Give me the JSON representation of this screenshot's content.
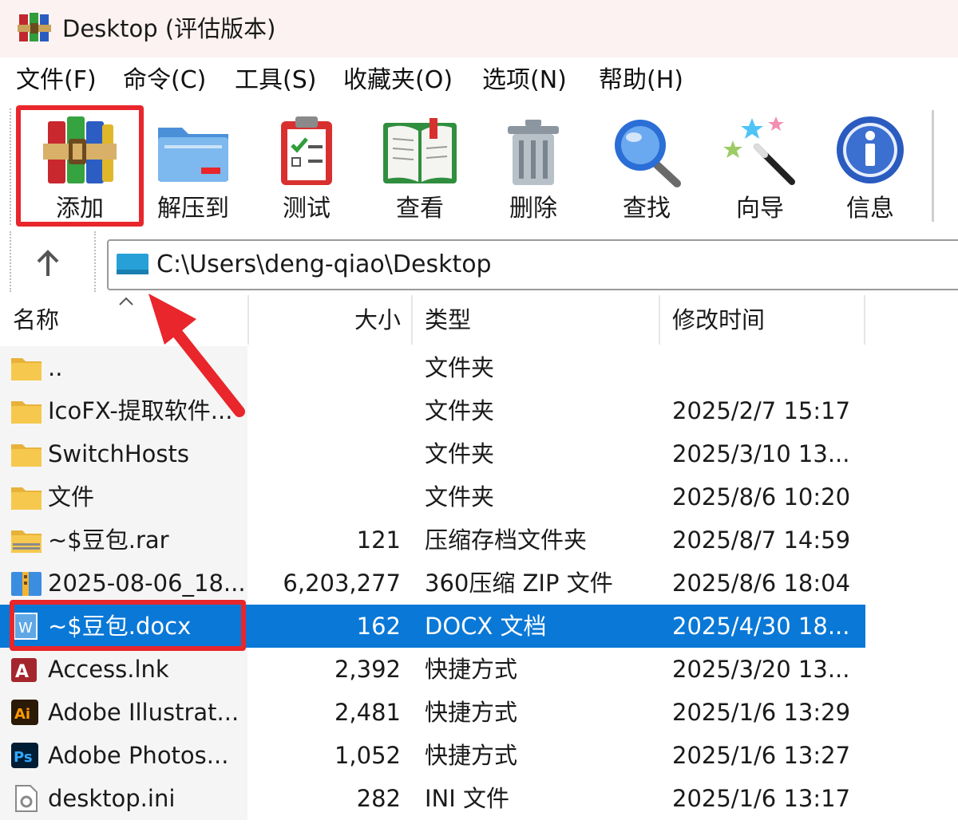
{
  "window": {
    "title": "Desktop (评估版本)"
  },
  "menu": [
    {
      "label": "文件(F)"
    },
    {
      "label": "命令(C)"
    },
    {
      "label": "工具(S)"
    },
    {
      "label": "收藏夹(O)"
    },
    {
      "label": "选项(N)"
    },
    {
      "label": "帮助(H)"
    }
  ],
  "toolbar": [
    {
      "label": "添加",
      "icon": "winrar-books-icon"
    },
    {
      "label": "解压到",
      "icon": "extract-folder-icon"
    },
    {
      "label": "测试",
      "icon": "clipboard-check-icon"
    },
    {
      "label": "查看",
      "icon": "open-book-icon"
    },
    {
      "label": "删除",
      "icon": "trash-icon"
    },
    {
      "label": "查找",
      "icon": "magnifier-icon"
    },
    {
      "label": "向导",
      "icon": "magic-wand-icon"
    },
    {
      "label": "信息",
      "icon": "info-icon"
    }
  ],
  "address": {
    "path": "C:\\Users\\deng-qiao\\Desktop"
  },
  "columns": {
    "name": "名称",
    "size": "大小",
    "type": "类型",
    "modified": "修改时间"
  },
  "files": [
    {
      "name": "..",
      "size": "",
      "type": "文件夹",
      "modified": "",
      "icon": "folder-icon"
    },
    {
      "name": "IcoFX-提取软件...",
      "size": "",
      "type": "文件夹",
      "modified": "2025/2/7 15:17",
      "icon": "folder-icon"
    },
    {
      "name": "SwitchHosts",
      "size": "",
      "type": "文件夹",
      "modified": "2025/3/10 13...",
      "icon": "folder-icon"
    },
    {
      "name": "文件",
      "size": "",
      "type": "文件夹",
      "modified": "2025/8/6 10:20",
      "icon": "folder-icon"
    },
    {
      "name": "~$豆包.rar",
      "size": "121",
      "type": "压缩存档文件夹",
      "modified": "2025/8/7 14:59",
      "icon": "zip-folder-icon"
    },
    {
      "name": "2025-08-06_18...",
      "size": "6,203,277",
      "type": "360压缩 ZIP 文件",
      "modified": "2025/8/6 18:04",
      "icon": "zip-archive-icon"
    },
    {
      "name": "~$豆包.docx",
      "size": "162",
      "type": "DOCX 文档",
      "modified": "2025/4/30 18...",
      "icon": "word-doc-icon",
      "selected": true
    },
    {
      "name": "Access.lnk",
      "size": "2,392",
      "type": "快捷方式",
      "modified": "2025/3/20 13...",
      "icon": "access-icon"
    },
    {
      "name": "Adobe Illustrat...",
      "size": "2,481",
      "type": "快捷方式",
      "modified": "2025/1/6 13:29",
      "icon": "illustrator-icon"
    },
    {
      "name": "Adobe Photos...",
      "size": "1,052",
      "type": "快捷方式",
      "modified": "2025/1/6 13:27",
      "icon": "photoshop-icon"
    },
    {
      "name": "desktop.ini",
      "size": "282",
      "type": "INI 文件",
      "modified": "2025/1/6 13:17",
      "icon": "ini-file-icon"
    }
  ],
  "colors": {
    "selection": "#0a78d7",
    "highlight": "#e8262b",
    "titlebar": "#fbf2f1"
  }
}
